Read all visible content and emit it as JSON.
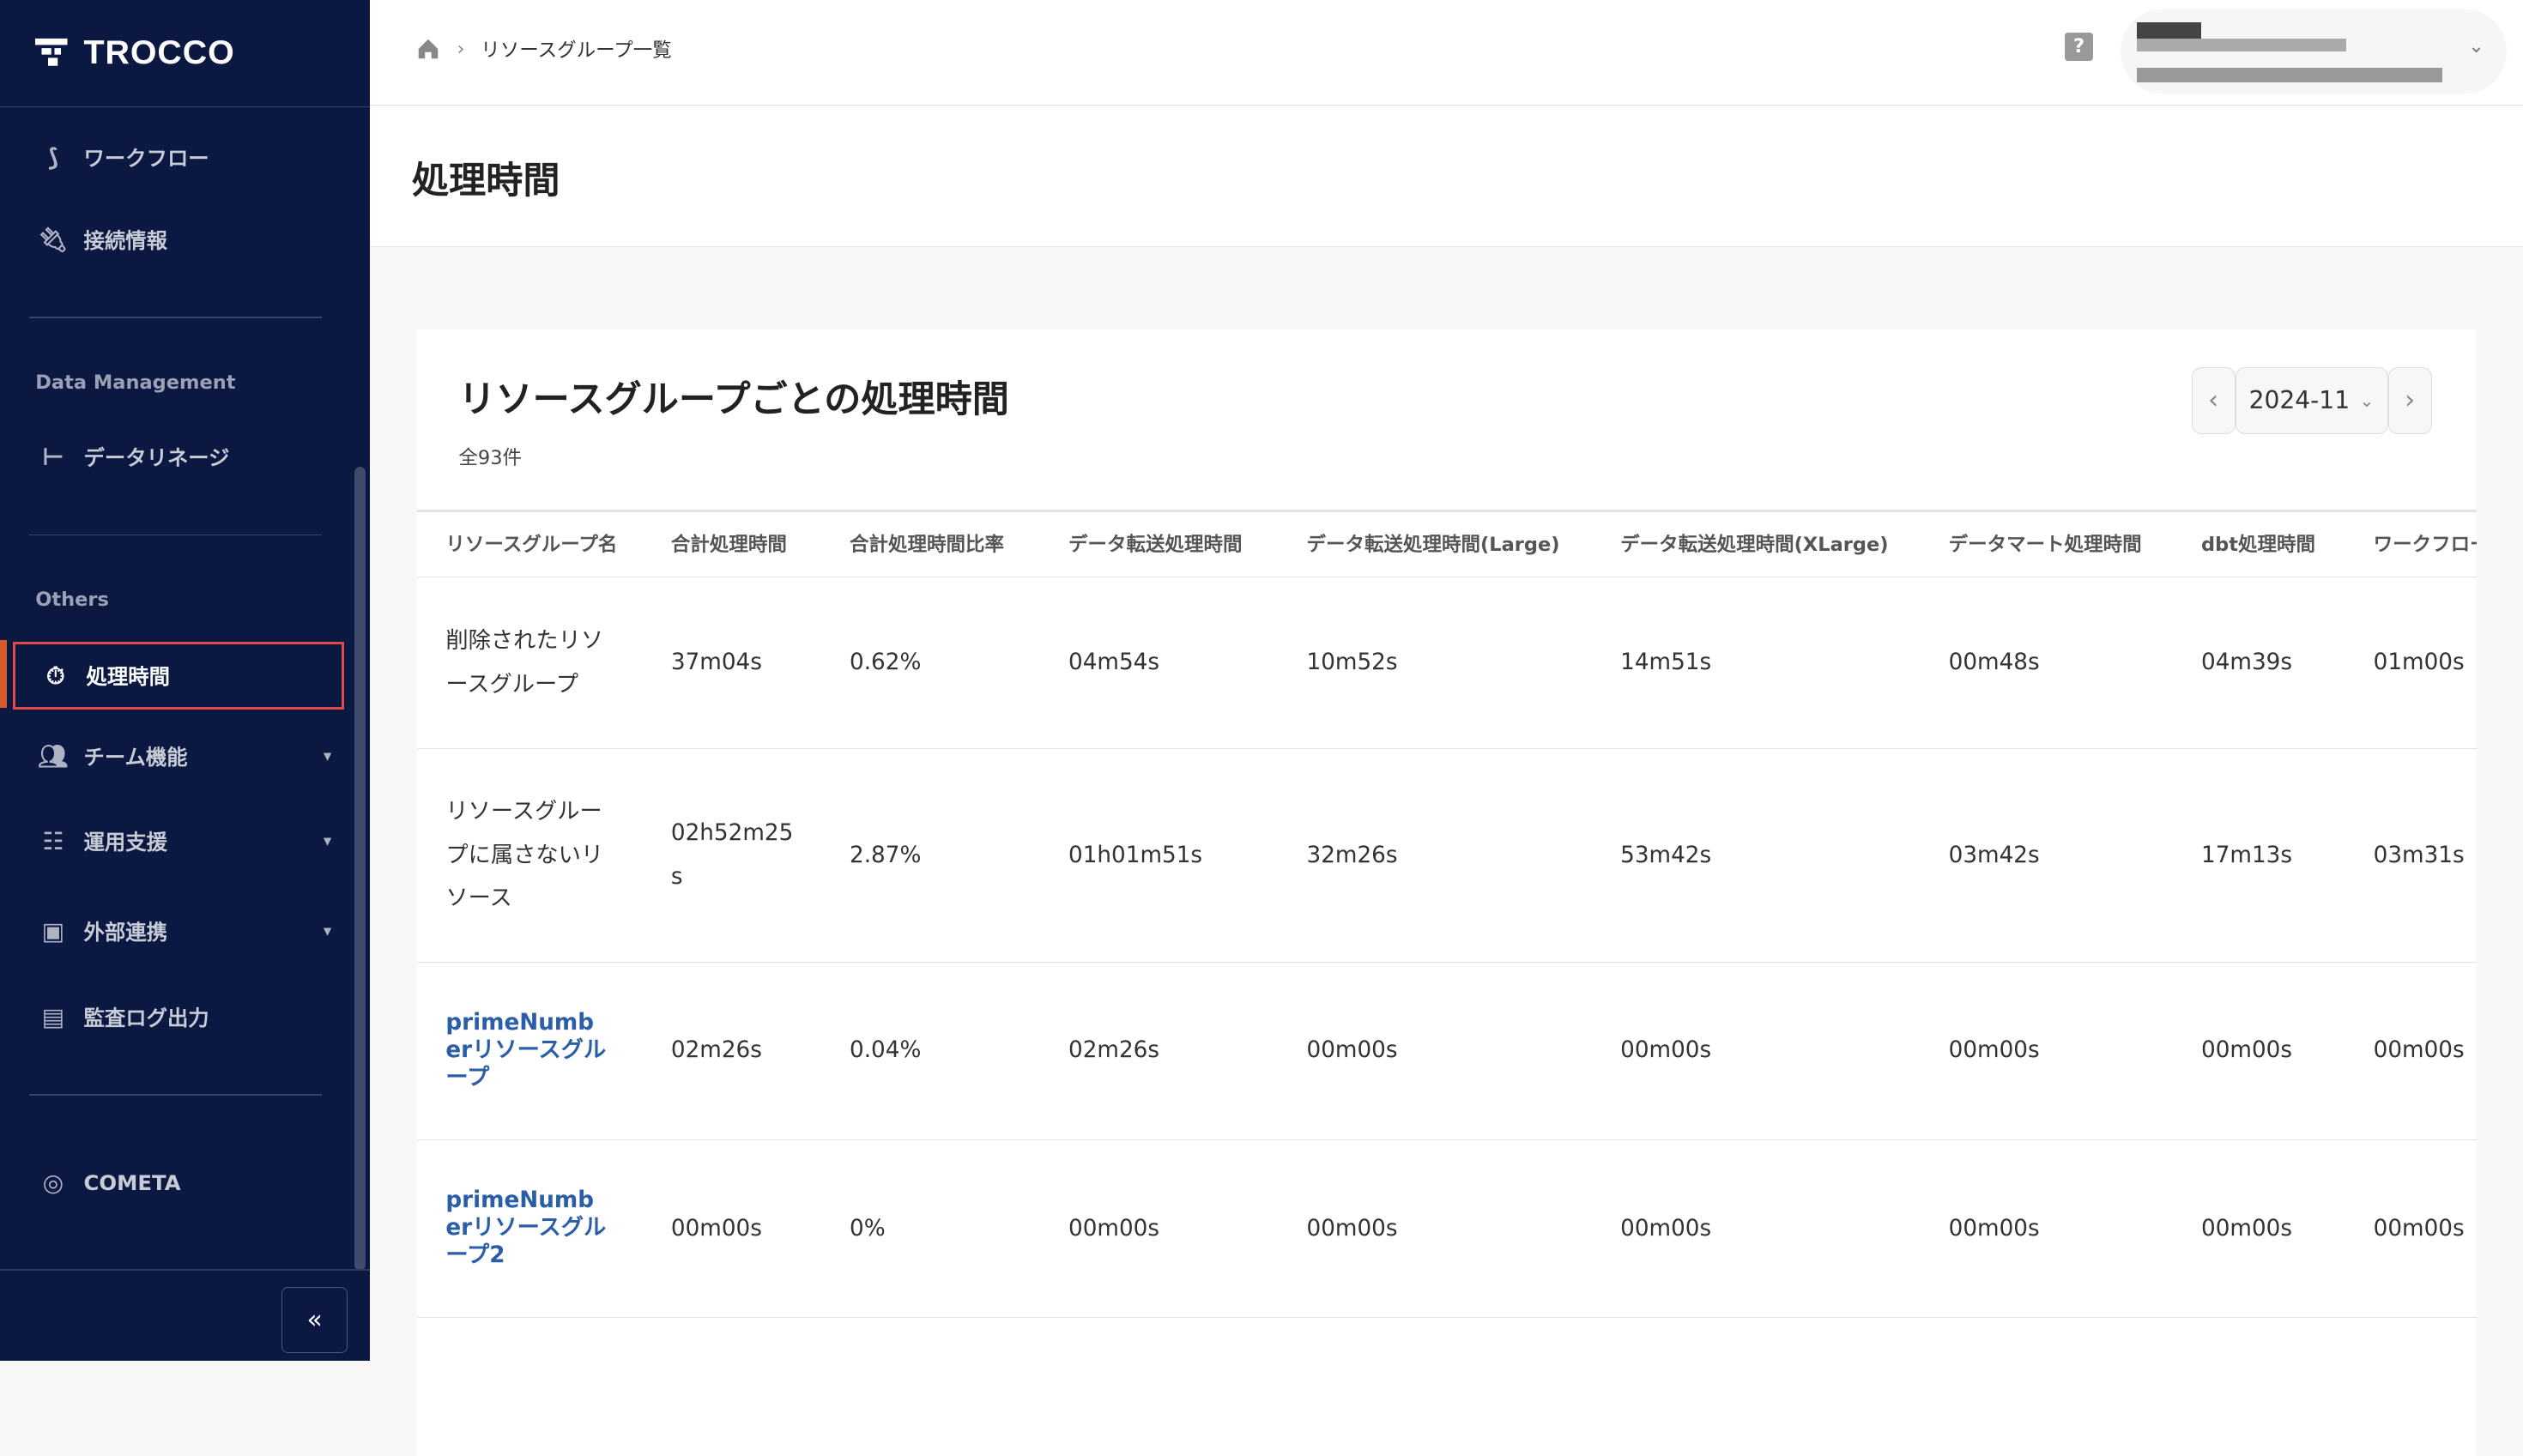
{
  "app": {
    "logo": "TROCCO"
  },
  "sidebar": {
    "items": [
      {
        "label": "ワークフロー",
        "icon": "workflow-icon"
      },
      {
        "label": "接続情報",
        "icon": "plug-icon"
      },
      {
        "label": "データリネージ",
        "icon": "lineage-icon"
      },
      {
        "label": "処理時間",
        "icon": "stopwatch-icon"
      },
      {
        "label": "チーム機能",
        "icon": "team-icon"
      },
      {
        "label": "運用支援",
        "icon": "sliders-icon"
      },
      {
        "label": "外部連携",
        "icon": "external-icon"
      },
      {
        "label": "監査ログ出力",
        "icon": "audit-log-icon"
      },
      {
        "label": "COMETA",
        "icon": "cometa-icon"
      }
    ],
    "sections": {
      "data_management": "Data Management",
      "others": "Others"
    },
    "collapse": "«"
  },
  "topbar": {
    "breadcrumb": "リソースグループ一覧",
    "help": "?"
  },
  "page": {
    "title": "処理時間"
  },
  "card": {
    "title": "リソースグループごとの処理時間",
    "count": "全93件",
    "month": "2024-11",
    "columns": [
      "リソースグループ名",
      "合計処理時間",
      "合計処理時間比率",
      "データ転送処理時間",
      "データ転送処理時間(Large)",
      "データ転送処理時間(XLarge)",
      "データマート処理時間",
      "dbt処理時間",
      "ワークフロー"
    ],
    "rows": [
      [
        "削除されたリソースグループ",
        "37m04s",
        "0.62%",
        "04m54s",
        "10m52s",
        "14m51s",
        "00m48s",
        "04m39s",
        "01m00s"
      ],
      [
        "リソースグループに属さないリソース",
        "02h52m25s",
        "2.87%",
        "01h01m51s",
        "32m26s",
        "53m42s",
        "03m42s",
        "17m13s",
        "03m31s"
      ],
      [
        "primeNumberリソースグループ",
        "02m26s",
        "0.04%",
        "02m26s",
        "00m00s",
        "00m00s",
        "00m00s",
        "00m00s",
        "00m00s"
      ],
      [
        "primeNumberリソースグループ2",
        "00m00s",
        "0%",
        "00m00s",
        "00m00s",
        "00m00s",
        "00m00s",
        "00m00s",
        "00m00s"
      ]
    ]
  },
  "colors": {
    "sidebar": "#0a1842",
    "active_border": "#e04a4a",
    "link": "#2b5ea8"
  }
}
